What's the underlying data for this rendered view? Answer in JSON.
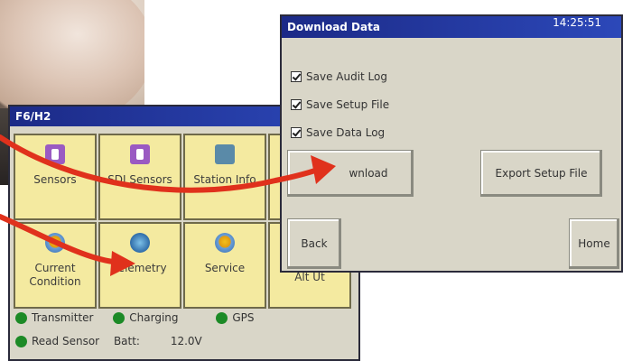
{
  "main_window": {
    "title": "F6/H2",
    "tiles": [
      {
        "label": "Sensors",
        "icon": "sensor-icon"
      },
      {
        "label": "SDI Sensors",
        "icon": "sdi-sensor-icon"
      },
      {
        "label": "Station Info",
        "icon": "station-info-icon"
      },
      {
        "label": "",
        "icon": ""
      },
      {
        "label": "Current Condition",
        "icon": "current-condition-icon"
      },
      {
        "label": "Telemetry",
        "icon": "telemetry-icon"
      },
      {
        "label": "Service",
        "icon": "service-icon"
      },
      {
        "label": "Alt Ut",
        "icon": ""
      }
    ],
    "status": {
      "transmitter": "Transmitter",
      "charging": "Charging",
      "gps": "GPS",
      "read_sensor": "Read Sensor",
      "batt_label": "Batt:",
      "batt_value": "12.0V"
    },
    "status_color": "#1c8a26"
  },
  "download_window": {
    "title": "Download Data",
    "clock": "14:25:51",
    "checkboxes": [
      {
        "label": "Save Audit Log",
        "checked": true
      },
      {
        "label": "Save Setup File",
        "checked": true
      },
      {
        "label": "Save Data Log",
        "checked": true
      }
    ],
    "buttons": {
      "download": "wnload",
      "export": "Export Setup File",
      "back": "Back",
      "home": "Home"
    }
  },
  "colors": {
    "title_bar": "#1c2a87",
    "tile": "#f4eaa0",
    "arrow": "#e0311c"
  }
}
